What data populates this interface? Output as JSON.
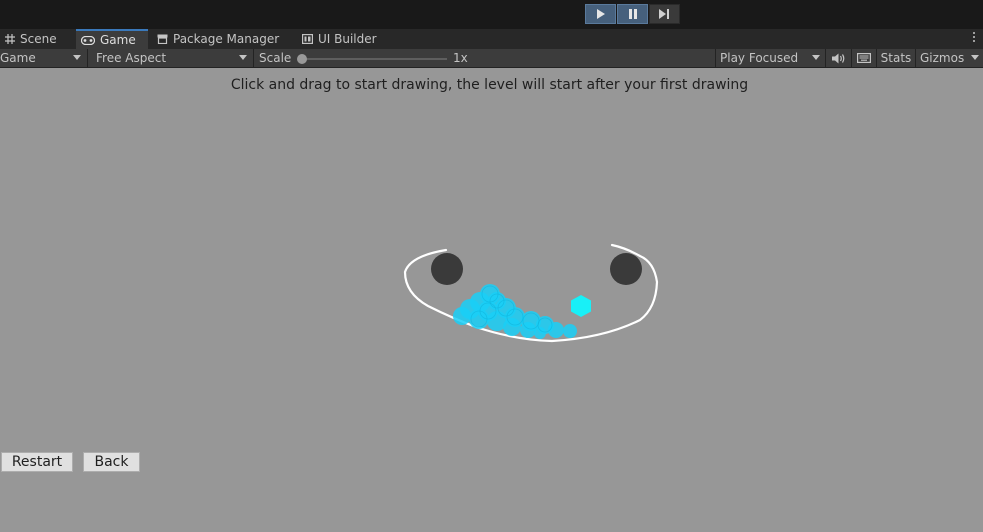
{
  "toolbar": {
    "play_icon": "play-icon",
    "pause_icon": "pause-icon",
    "step_icon": "step-icon",
    "accent_color": "#46607c"
  },
  "tabs": [
    {
      "label": "Scene",
      "icon": "grid-icon",
      "active": false
    },
    {
      "label": "Game",
      "icon": "gamepad-icon",
      "active": true
    },
    {
      "label": "Package Manager",
      "icon": "package-icon",
      "active": false
    },
    {
      "label": "UI Builder",
      "icon": "ui-builder-icon",
      "active": false
    }
  ],
  "game_toolbar": {
    "display": "Game",
    "aspect": "Free Aspect",
    "scale_label": "Scale",
    "scale_value": "1x",
    "scale_level": 0,
    "play_mode": "Play Focused",
    "stats_label": "Stats",
    "gizmos_label": "Gizmos"
  },
  "game": {
    "hint": "Click and drag to start drawing, the level will start after your first drawing",
    "background_color": "#979797",
    "water_color": "#19cff7",
    "goal_color": "#18f0f7",
    "buttons": {
      "restart": "Restart",
      "back": "Back"
    }
  }
}
